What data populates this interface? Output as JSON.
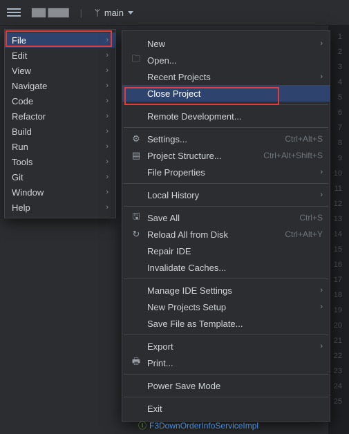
{
  "toolbar": {
    "project_name": "▇▇ ▇▇▇",
    "branch_label": "main"
  },
  "main_menu": [
    {
      "label": "File",
      "selected": true
    },
    {
      "label": "Edit",
      "selected": false
    },
    {
      "label": "View",
      "selected": false
    },
    {
      "label": "Navigate",
      "selected": false
    },
    {
      "label": "Code",
      "selected": false
    },
    {
      "label": "Refactor",
      "selected": false
    },
    {
      "label": "Build",
      "selected": false
    },
    {
      "label": "Run",
      "selected": false
    },
    {
      "label": "Tools",
      "selected": false
    },
    {
      "label": "Git",
      "selected": false
    },
    {
      "label": "Window",
      "selected": false
    },
    {
      "label": "Help",
      "selected": false
    }
  ],
  "file_menu": [
    {
      "type": "item",
      "icon": "",
      "label": "New",
      "shortcut": "",
      "arrow": true,
      "selected": false
    },
    {
      "type": "item",
      "icon": "folder",
      "label": "Open...",
      "shortcut": "",
      "arrow": false,
      "selected": false
    },
    {
      "type": "item",
      "icon": "",
      "label": "Recent Projects",
      "shortcut": "",
      "arrow": true,
      "selected": false
    },
    {
      "type": "item",
      "icon": "",
      "label": "Close Project",
      "shortcut": "",
      "arrow": false,
      "selected": true
    },
    {
      "type": "sep"
    },
    {
      "type": "item",
      "icon": "",
      "label": "Remote Development...",
      "shortcut": "",
      "arrow": false,
      "selected": false
    },
    {
      "type": "sep"
    },
    {
      "type": "item",
      "icon": "gear",
      "label": "Settings...",
      "shortcut": "Ctrl+Alt+S",
      "arrow": false,
      "selected": false
    },
    {
      "type": "item",
      "icon": "struct",
      "label": "Project Structure...",
      "shortcut": "Ctrl+Alt+Shift+S",
      "arrow": false,
      "selected": false
    },
    {
      "type": "item",
      "icon": "",
      "label": "File Properties",
      "shortcut": "",
      "arrow": true,
      "selected": false
    },
    {
      "type": "sep"
    },
    {
      "type": "item",
      "icon": "",
      "label": "Local History",
      "shortcut": "",
      "arrow": true,
      "selected": false
    },
    {
      "type": "sep"
    },
    {
      "type": "item",
      "icon": "save",
      "label": "Save All",
      "shortcut": "Ctrl+S",
      "arrow": false,
      "selected": false
    },
    {
      "type": "item",
      "icon": "reload",
      "label": "Reload All from Disk",
      "shortcut": "Ctrl+Alt+Y",
      "arrow": false,
      "selected": false
    },
    {
      "type": "item",
      "icon": "",
      "label": "Repair IDE",
      "shortcut": "",
      "arrow": false,
      "selected": false
    },
    {
      "type": "item",
      "icon": "",
      "label": "Invalidate Caches...",
      "shortcut": "",
      "arrow": false,
      "selected": false
    },
    {
      "type": "sep"
    },
    {
      "type": "item",
      "icon": "",
      "label": "Manage IDE Settings",
      "shortcut": "",
      "arrow": true,
      "selected": false
    },
    {
      "type": "item",
      "icon": "",
      "label": "New Projects Setup",
      "shortcut": "",
      "arrow": true,
      "selected": false
    },
    {
      "type": "item",
      "icon": "",
      "label": "Save File as Template...",
      "shortcut": "",
      "arrow": false,
      "selected": false
    },
    {
      "type": "sep"
    },
    {
      "type": "item",
      "icon": "",
      "label": "Export",
      "shortcut": "",
      "arrow": true,
      "selected": false
    },
    {
      "type": "item",
      "icon": "print",
      "label": "Print...",
      "shortcut": "",
      "arrow": false,
      "selected": false
    },
    {
      "type": "sep"
    },
    {
      "type": "item",
      "icon": "",
      "label": "Power Save Mode",
      "shortcut": "",
      "arrow": false,
      "selected": false
    },
    {
      "type": "sep"
    },
    {
      "type": "item",
      "icon": "",
      "label": "Exit",
      "shortcut": "",
      "arrow": false,
      "selected": false
    }
  ],
  "gutter_lines": [
    "1",
    "2",
    "3",
    "4",
    "5",
    "6",
    "7",
    "8",
    "9",
    "10",
    "11",
    "12",
    "13",
    "14",
    "15",
    "16",
    "17",
    "18",
    "19",
    "20",
    "21",
    "22",
    "23",
    "24",
    "25"
  ],
  "bottom_file_label": "F3DownOrderInfoServiceImpl",
  "icons": {
    "folder": "🗀",
    "gear": "⚙",
    "struct": "▤",
    "save": "🖫",
    "reload": "↻",
    "print": "🖶",
    "branch": "ᛘ"
  }
}
